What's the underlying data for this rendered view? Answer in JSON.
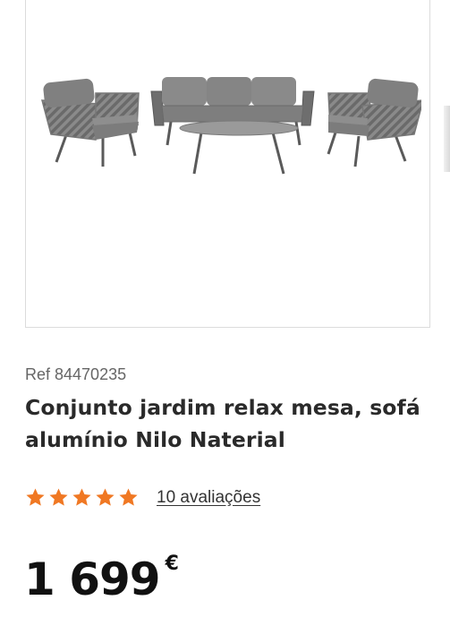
{
  "product": {
    "image_alt": "Conjunto jardim relax mesa, sofá alumínio Nilo Naterial",
    "ref": "Ref 84470235",
    "title": "Conjunto jardim relax mesa, sofá alumínio Nilo Naterial",
    "rating": {
      "value": 5,
      "max": 5,
      "reviews_label": "10 avaliações"
    },
    "price": {
      "amount": "1 699",
      "currency": "€"
    }
  },
  "colors": {
    "star": "#f07823",
    "text": "#2b2b2b",
    "price": "#111111"
  }
}
